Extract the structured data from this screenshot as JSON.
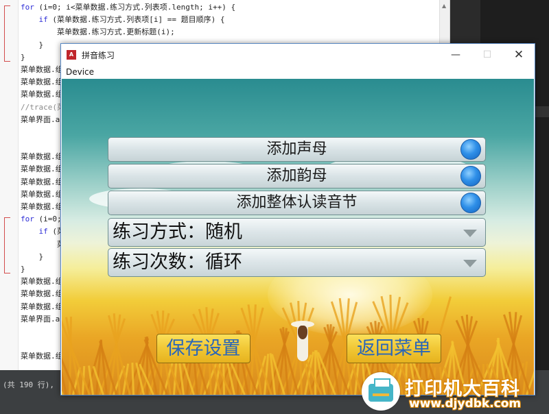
{
  "editor": {
    "lines": [
      {
        "text": "for (i=0; i<菜单数据.练习方式.列表项.length; i++) {",
        "kind": "code"
      },
      {
        "text": "    if (菜单数据.练习方式.列表项[i] == 题目顺序) {",
        "kind": "code"
      },
      {
        "text": "        菜单数据.练习方式.更新标题(i);",
        "kind": "code"
      },
      {
        "text": "    }",
        "kind": "code"
      },
      {
        "text": "}",
        "kind": "code"
      },
      {
        "text": "菜单数据.组",
        "kind": "code"
      },
      {
        "text": "菜单数据.组",
        "kind": "code"
      },
      {
        "text": "菜单数据.组",
        "kind": "code"
      },
      {
        "text": "//trace(菜单",
        "kind": "comment"
      },
      {
        "text": "菜单界面.a",
        "kind": "code"
      },
      {
        "text": "",
        "kind": "code"
      },
      {
        "text": "",
        "kind": "code"
      },
      {
        "text": "菜单数据.组",
        "kind": "code"
      },
      {
        "text": "菜单数据.组",
        "kind": "code"
      },
      {
        "text": "菜单数据.组",
        "kind": "code"
      },
      {
        "text": "菜单数据.组",
        "kind": "code"
      },
      {
        "text": "菜单数据.组",
        "kind": "code"
      },
      {
        "text": "for (i=0; i",
        "kind": "code"
      },
      {
        "text": "    if (菜单",
        "kind": "code"
      },
      {
        "text": "        菜单",
        "kind": "code"
      },
      {
        "text": "    }",
        "kind": "code"
      },
      {
        "text": "}",
        "kind": "code"
      },
      {
        "text": "菜单数据.组",
        "kind": "code"
      },
      {
        "text": "菜单数据.组",
        "kind": "code"
      },
      {
        "text": "菜单数据.组",
        "kind": "code"
      },
      {
        "text": "菜单界面.a",
        "kind": "code"
      },
      {
        "text": "",
        "kind": "code"
      },
      {
        "text": "",
        "kind": "code"
      },
      {
        "text": "菜单数据.组",
        "kind": "code"
      }
    ],
    "status_text": "(共 190 行),"
  },
  "window": {
    "title": "拼音练习",
    "icon_letter": "A",
    "menu_device": "Device",
    "minimize_symbol": "—",
    "maximize_symbol": "☐",
    "close_symbol": "✕"
  },
  "options": [
    {
      "label": "添加声母",
      "enabled": true
    },
    {
      "label": "添加韵母",
      "enabled": true
    },
    {
      "label": "添加整体认读音节",
      "enabled": true
    }
  ],
  "selects": [
    {
      "label": "练习方式：随机"
    },
    {
      "label": "练习次数：循环"
    }
  ],
  "buttons": {
    "save": "保存设置",
    "back": "返回菜单"
  },
  "watermark": {
    "title": "打印机大百科",
    "url": "www.djydbk.com"
  },
  "colors": {
    "toggle_blue": "#2e8fe8",
    "button_text": "#2a66b8",
    "button_gold": "#f1c735"
  }
}
